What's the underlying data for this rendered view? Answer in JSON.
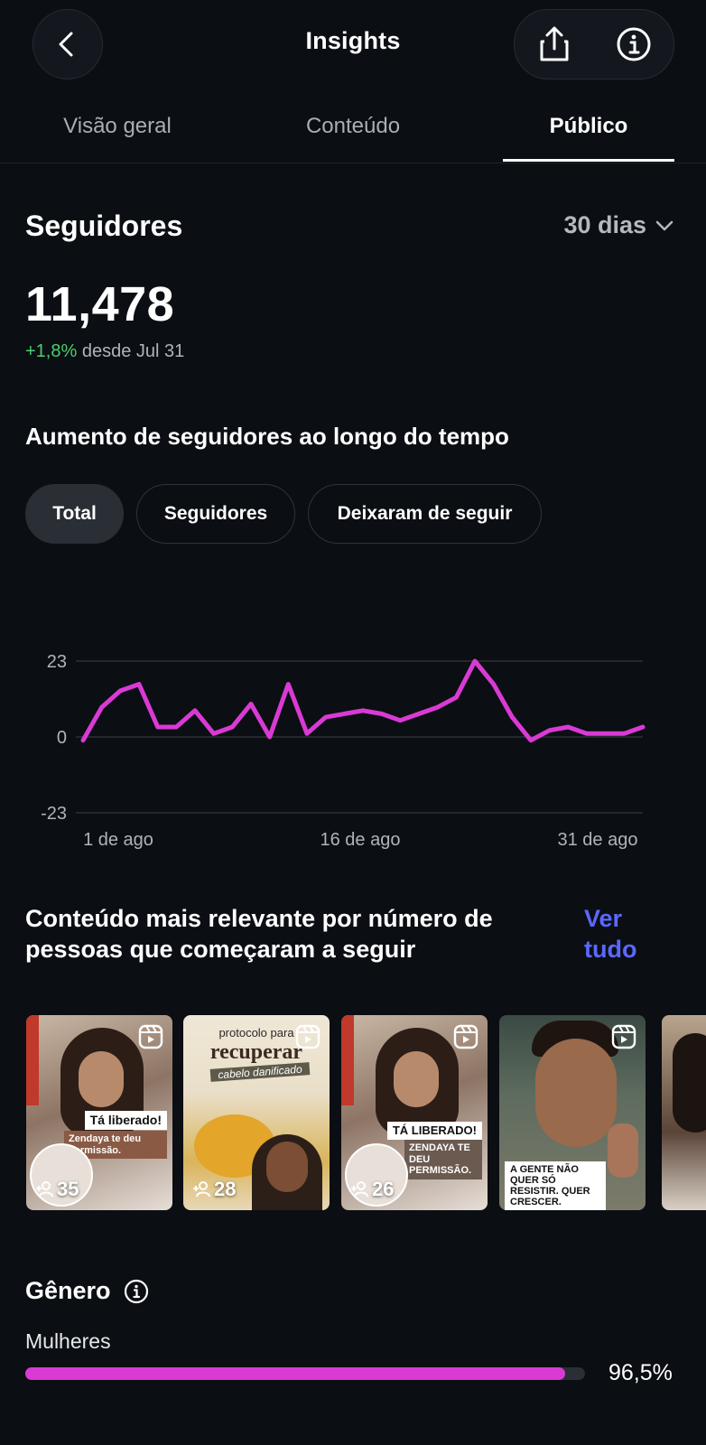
{
  "header": {
    "title": "Insights",
    "back_icon": "chevron-left-icon",
    "share_icon": "share-icon",
    "info_icon": "info-icon"
  },
  "tabs": [
    {
      "label": "Visão geral",
      "active": false
    },
    {
      "label": "Conteúdo",
      "active": false
    },
    {
      "label": "Público",
      "active": true
    }
  ],
  "followers": {
    "title": "Seguidores",
    "period": "30 dias",
    "count": "11,478",
    "delta": "+1,8%",
    "delta_since": "desde Jul 31"
  },
  "growth": {
    "title": "Aumento de seguidores ao longo do tempo",
    "chips": [
      {
        "label": "Total",
        "active": true
      },
      {
        "label": "Seguidores",
        "active": false
      },
      {
        "label": "Deixaram de seguir",
        "active": false
      }
    ]
  },
  "chart_data": {
    "type": "line",
    "x_ticks": [
      "1 de ago",
      "16 de ago",
      "31 de ago"
    ],
    "y_ticks": [
      "23",
      "0",
      "-23"
    ],
    "ylim": [
      -23,
      23
    ],
    "series": [
      {
        "color": "#d93ad4",
        "values": [
          -1,
          9,
          14,
          16,
          3,
          3,
          8,
          1,
          3,
          10,
          0,
          16,
          1,
          6,
          7,
          8,
          7,
          5,
          7,
          9,
          12,
          23,
          16,
          6,
          -1,
          2,
          3,
          1,
          1,
          1,
          3
        ]
      }
    ],
    "grid": true
  },
  "relevant": {
    "title": "Conteúdo mais relevante por número de pessoas que começaram a seguir",
    "see_all": "Ver tudo",
    "items": [
      {
        "count": "35",
        "caption": "Tá liberado!",
        "sub": "Zendaya te deu permissão."
      },
      {
        "count": "28",
        "caption": "recuperar",
        "sub": "cabelo danificado",
        "top": "protocolo para"
      },
      {
        "count": "26",
        "caption": "TÁ LIBERADO!",
        "sub": "ZENDAYA TE DEU PERMISSÃO."
      },
      {
        "count": "",
        "caption": "A GENTE NÃO QUER SÓ RESISTIR. QUER CRESCER."
      },
      {
        "count": ""
      }
    ]
  },
  "gender": {
    "title": "Gênero",
    "women_label": "Mulheres",
    "women_value": "96,5%",
    "women_fraction": 0.965,
    "bar_color": "#d93ad4"
  }
}
